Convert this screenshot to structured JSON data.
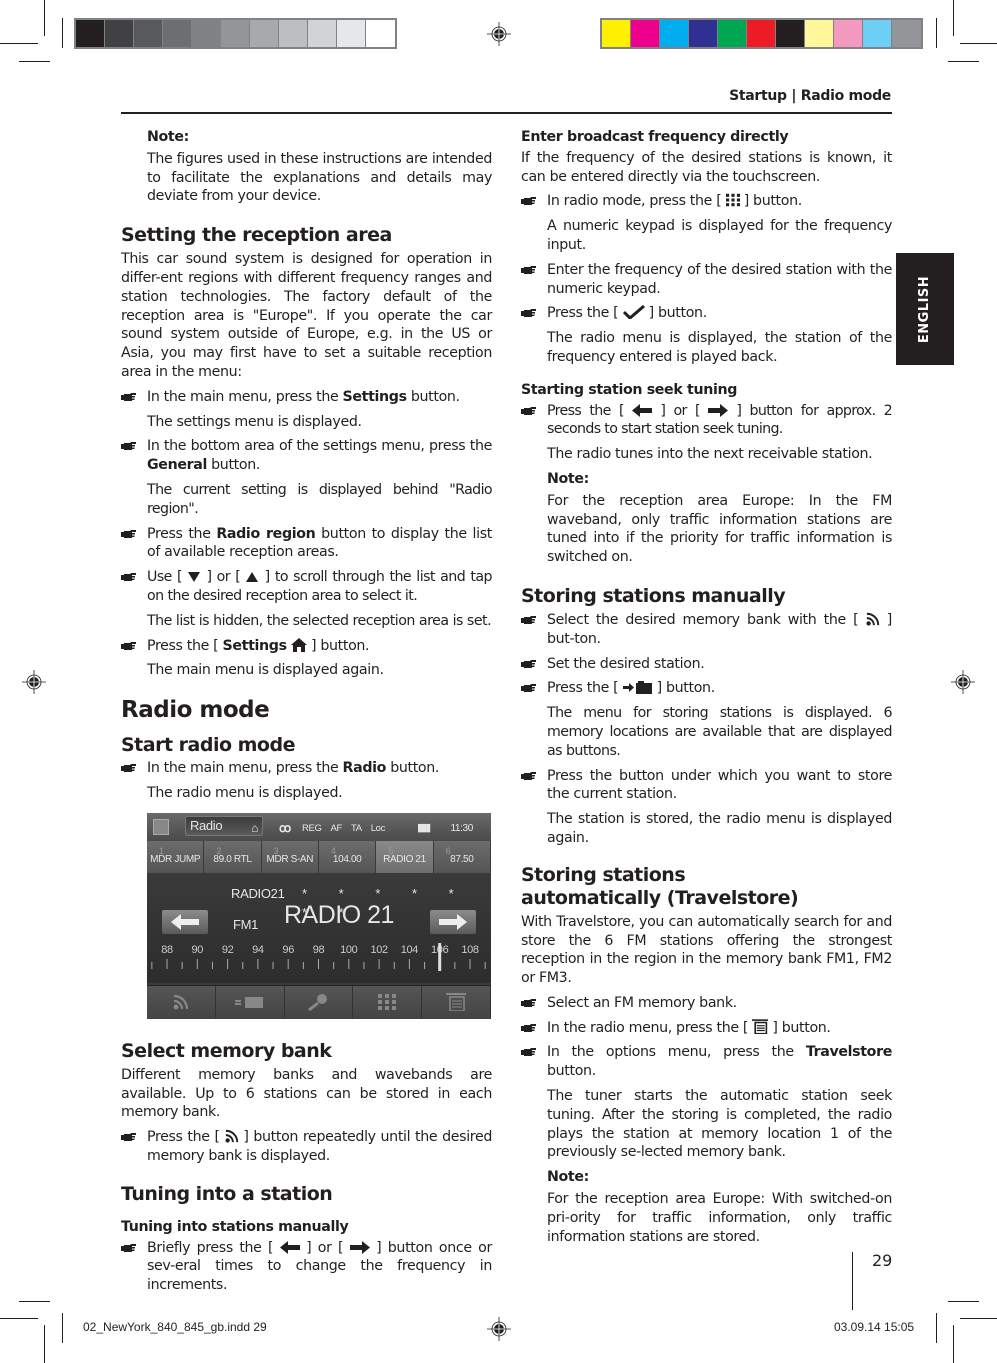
{
  "header": {
    "title": "Startup | Radio mode",
    "language_tab": "ENGLISH"
  },
  "print_marks": {
    "gray_swatches": [
      "#231f20",
      "#414042",
      "#58595b",
      "#6d6e71",
      "#808285",
      "#939598",
      "#a7a9ac",
      "#bcbec0",
      "#d1d3d4",
      "#e6e7e8",
      "#ffffff"
    ],
    "color_swatches": [
      "#fff200",
      "#ec008c",
      "#00aeef",
      "#2e3192",
      "#00a651",
      "#ed1c24",
      "#231f20",
      "#fff799",
      "#f49ac1",
      "#6dcff6",
      "#939598"
    ]
  },
  "left": {
    "note": {
      "label": "Note:",
      "text": "The figures used in these instructions are intended to facilitate the explanations and details may deviate from your device."
    },
    "reception": {
      "heading": "Setting the reception area",
      "intro": "This car sound system is designed for operation in differ-ent regions with different frequency ranges and station technologies. The factory default of the reception area is \"Europe\". If you operate the car sound system outside of Europe, e.g. in the US or Asia, you may first have to set a suitable reception area in the menu:",
      "s1_pre": "In the main menu, press the ",
      "s1_bold": "Settings",
      "s1_post": " button.",
      "r1": "The settings menu is displayed.",
      "s2_pre": "In the bottom area of the settings menu, press the ",
      "s2_bold": "General",
      "s2_post": " button.",
      "r2": "The current setting is displayed behind \"Radio region\".",
      "s3_pre": "Press the ",
      "s3_bold": "Radio region",
      "s3_post": " button to display the list of available reception areas.",
      "s4_a": "Use [ ",
      "s4_b": " ] or [ ",
      "s4_c": " ] to scroll through the list and tap on the desired reception area to select it.",
      "r4": "The list is hidden, the selected reception area is set.",
      "s5_pre": "Press the [ ",
      "s5_bold": "Settings",
      "s5_post": " ] button.",
      "r5": "The main menu is displayed again."
    },
    "radio_mode": {
      "heading": "Radio mode",
      "start_heading": "Start radio mode",
      "s1_pre": "In the main menu, press the ",
      "s1_bold": "Radio",
      "s1_post": " button.",
      "r1": "The radio menu is displayed."
    },
    "memory": {
      "heading": "Select memory bank",
      "intro": "Different memory banks and wavebands are available. Up to 6 stations can be stored in each memory bank.",
      "s1_pre": "Press the [ ",
      "s1_post": " ] button repeatedly until the desired memory bank is displayed."
    },
    "tuning": {
      "heading": "Tuning into a station",
      "sub": "Tuning into stations manually",
      "s1_a": "Briefly press the [ ",
      "s1_b": " ] or [ ",
      "s1_c": " ] button once or sev-eral times to change the frequency in increments."
    }
  },
  "radio_screen": {
    "source": "Radio",
    "flags": [
      "REG",
      "AF",
      "TA",
      "Loc"
    ],
    "time": "11:30",
    "presets": [
      {
        "n": "1",
        "v": "MDR JUMP"
      },
      {
        "n": "2",
        "v": "89.0 RTL"
      },
      {
        "n": "3",
        "v": "MDR S-AN"
      },
      {
        "n": "4",
        "v": "104.00"
      },
      {
        "n": "5",
        "v": "RADIO 21",
        "active": true
      },
      {
        "n": "6",
        "v": "87.50"
      }
    ],
    "radiotext": "RADIO21",
    "stars": "* * * * * * *",
    "band": "FM1",
    "station": "RADIO 21",
    "scale_labels": [
      "88",
      "90",
      "92",
      "94",
      "96",
      "98",
      "100",
      "102",
      "104",
      "106",
      "108"
    ],
    "tuned_mhz": 106,
    "bottom_buttons": [
      "memory-bank-icon",
      "store-icon",
      "search-icon",
      "keypad-icon",
      "options-icon"
    ]
  },
  "right": {
    "direct": {
      "heading": "Enter broadcast frequency directly",
      "intro": "If the frequency of the desired stations is known, it can be entered directly via the touchscreen.",
      "s1_pre": "In radio mode, press the [ ",
      "s1_post": " ] button.",
      "r1": "A numeric keypad is displayed for the frequency input.",
      "s2": "Enter the frequency of the desired station with the numeric keypad.",
      "s3_pre": "Press the [ ",
      "s3_post": " ] button.",
      "r3": "The radio menu is displayed, the station of the frequency entered is played back."
    },
    "seek": {
      "heading": "Starting station seek tuning",
      "s1_a": "Press the [ ",
      "s1_b": " ] or [ ",
      "s1_c": " ] button for approx. 2 seconds to start station seek tuning.",
      "r1": "The radio tunes into the next receivable station.",
      "note_label": "Note:",
      "note": "For the reception area Europe: In the FM waveband, only traffic information stations are tuned into if the priority for traffic information is switched on."
    },
    "manual_store": {
      "heading": "Storing stations manually",
      "s1_pre": "Select the desired memory bank with the [ ",
      "s1_post": " ] but-ton.",
      "s2": "Set the desired station.",
      "s3_pre": "Press the [ ",
      "s3_post": " ] button.",
      "r3": "The menu for storing stations is displayed. 6 memory locations are available that are displayed as buttons.",
      "s4": "Press the button under which you want to store the current station.",
      "r4": "The station is stored, the radio menu is displayed again."
    },
    "auto_store": {
      "heading": "Storing stations automatically (Travelstore)",
      "intro": "With Travelstore, you can automatically search for and store the 6 FM stations offering the strongest reception in the region in the memory bank FM1, FM2 or FM3.",
      "s1": "Select an FM memory bank.",
      "s2_pre": "In the radio menu, press the [ ",
      "s2_post": " ] button.",
      "s3_pre": "In the options menu, press the ",
      "s3_bold": "Travelstore",
      "s3_post": " button.",
      "r3": "The tuner starts the automatic station seek tuning. After the storing is completed, the radio plays the station at memory location 1 of the previously se-lected memory bank.",
      "note_label": "Note:",
      "note": "For the reception area Europe: With switched-on pri-ority for traffic information, only traffic information stations are stored."
    }
  },
  "footer": {
    "page_number": "29",
    "slug_file": "02_NewYork_840_845_gb.indd   29",
    "slug_date": "03.09.14   15:05"
  }
}
